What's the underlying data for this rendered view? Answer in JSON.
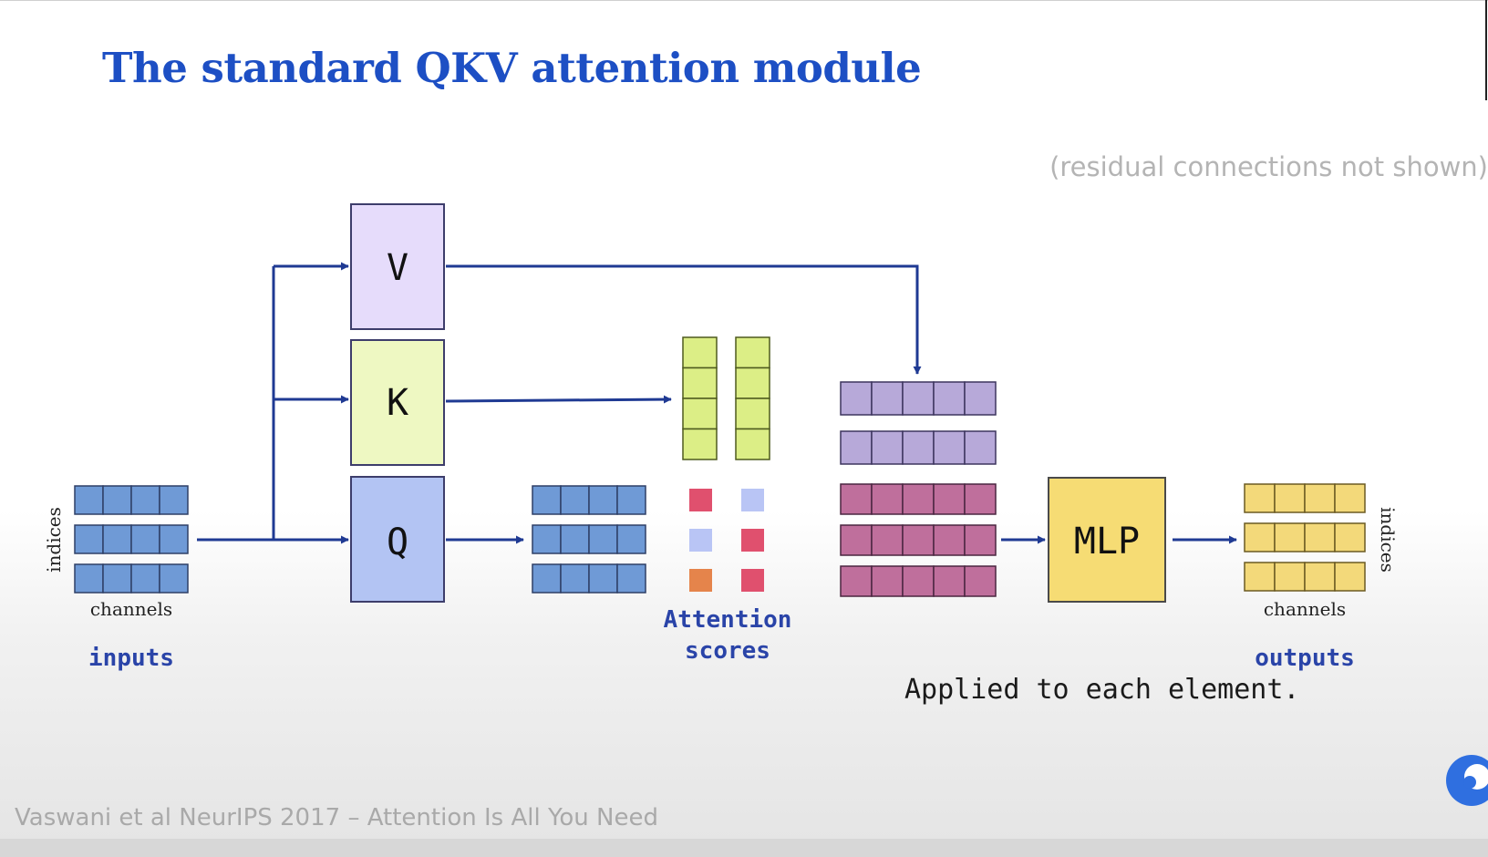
{
  "slide": {
    "title": "The standard QKV attention module",
    "note": "(residual connections not shown)",
    "footer": "Vaswani et al NeurIPS 2017 – Attention Is All You Need"
  },
  "diagram": {
    "inputs_label": "inputs",
    "outputs_label": "outputs",
    "indices_label": "indices",
    "channels_label": "channels",
    "v_label": "V",
    "k_label": "K",
    "q_label": "Q",
    "mlp_label": "MLP",
    "attention_label_line1": "Attention",
    "attention_label_line2": "scores",
    "caption": "Applied to each element."
  },
  "colors": {
    "title": "#1d4fc4",
    "label_blue": "#2a44a8",
    "arrow": "#1f3a93",
    "input_cells": "#6f9ad6",
    "v_box": "#e6dcfb",
    "k_box": "#eef8c2",
    "q_box": "#b3c4f3",
    "key_cells": "#dcee86",
    "value_cells": "#b7a9d9",
    "weighted_cells": "#bf6f9c",
    "mlp_box": "#f6dc74",
    "output_cells": "#f3d97a",
    "score_red": "#e0506e",
    "score_light": "#b9c5f5",
    "score_orange": "#e5844b"
  },
  "icons": {
    "brand_logo": "brand-swirl-icon"
  }
}
